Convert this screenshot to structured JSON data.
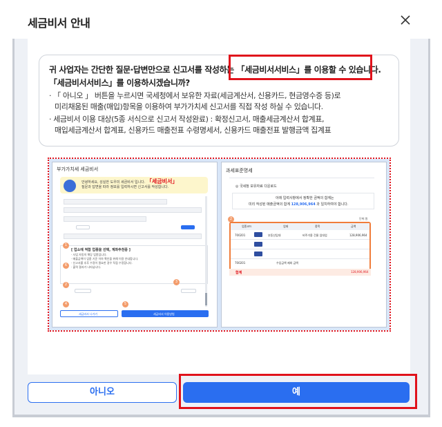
{
  "dialog": {
    "title": "세금비서 안내",
    "close_icon": "close-icon"
  },
  "notice": {
    "line1": "귀 사업자는 간단한 질문·답변만으로 신고서를 작성하는 「세금비서서비스」를 이용할 수 있습니다.",
    "line2": "「세금비서서비스」를 이용하시겠습니까?",
    "bullet1_a": "· 「 아니오 」 버튼을 누르시면 국세청에서 보유한 자료(세금계산서, 신용카드, 현금영수증 등)로",
    "bullet1_b": "미리채움된 매출(매입)항목을 이용하여 부가가치세 신고서를 직접 작성 하실 수 있습니다.",
    "bullet2_a": "· 세금비서 이용 대상(5종 서식으로 신고서 작성완료) : 확정신고서, 매출세금계산서 합계표,",
    "bullet2_b": "매입세금계산서 합계표, 신용카드 매출전표 수령명세서, 신용카드 매출전표 발행금액 집계표"
  },
  "preview": {
    "left": {
      "title": "부가가치세 세금비서",
      "banner_line1": "안녕하세요, 성실한 도우미 세금비서 입니다.",
      "banner_brand": "「세금비서」",
      "banner_line2": "질문과 답변을 따라 정보를 입력하시면 신고서를 작성합니다.",
      "box_title": "[ 업소에 적합 업종을 선택, 계좌추천중 ]",
      "box_text_1": "· 사업 자동의 해당 업종입니다.",
      "box_text_2": "· 매출금액이 업종 기준 이하 확인을 위해 이용 안내합니다.",
      "box_text_3": "· 신고서를 추후 수정이 필요한 경우 직접 수정합니다.",
      "box_text_4": "· 출력 결과가 나타납니다.",
      "btn_white_label": "세금비서 나가기",
      "btn_blue_label": "세금비서 이용방법",
      "numbers": [
        "1",
        "2",
        "3",
        "4",
        "5",
        "6"
      ]
    },
    "right": {
      "title": "과세표준명세",
      "option": "◎ 국세청 보유자료 다운로드",
      "info_line1": "아래 입력사항에서 정확한 금액의 합계는",
      "info_line2_prefix": "미리 작성된 매출금액의 합계",
      "info_amount": "128,906,964",
      "info_line2_suffix": "과 일치하여야 합니다.",
      "unit": "단위:원",
      "headers": [
        "업종코드",
        "업태",
        "종목",
        "금액"
      ],
      "row1_code": "700201",
      "row1_name": "부동산임대",
      "row1_item": "비주거용 건물 임대업",
      "row1_amount": "128,906,964",
      "row3_code": "700201",
      "row3_name": "수입금액 제외 금액",
      "total_label": "합계",
      "total_value": "128,906,964",
      "badge_num": "2"
    }
  },
  "buttons": {
    "no": "아니오",
    "yes": "예"
  },
  "colors": {
    "primary": "#2a6ef0",
    "highlight": "#e0121b",
    "accent_orange": "#f07c3a"
  }
}
